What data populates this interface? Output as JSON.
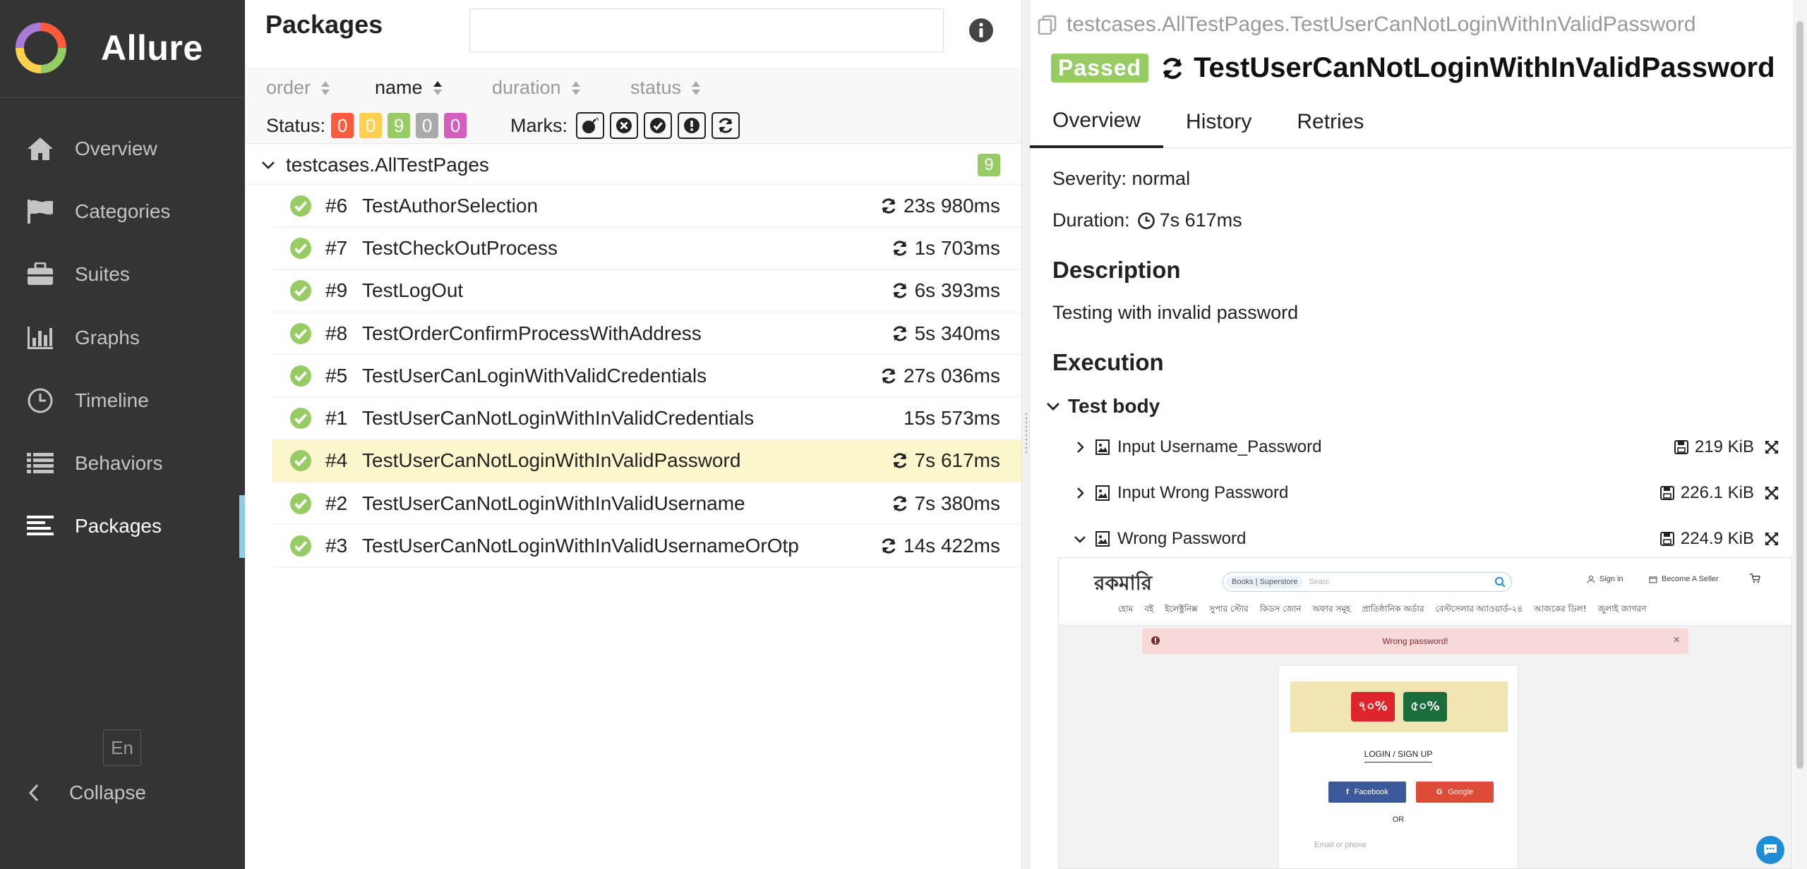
{
  "sidebar": {
    "brand": "Allure",
    "items": [
      {
        "label": "Overview",
        "icon": "home-icon"
      },
      {
        "label": "Categories",
        "icon": "flag-icon"
      },
      {
        "label": "Suites",
        "icon": "briefcase-icon"
      },
      {
        "label": "Graphs",
        "icon": "bar-chart-icon"
      },
      {
        "label": "Timeline",
        "icon": "clock-icon"
      },
      {
        "label": "Behaviors",
        "icon": "list-icon"
      },
      {
        "label": "Packages",
        "icon": "align-left-icon",
        "active": true
      }
    ],
    "language": "En",
    "collapse": "Collapse"
  },
  "packages": {
    "title": "Packages",
    "search_value": "",
    "sort": {
      "order": "order",
      "name": "name",
      "duration": "duration",
      "status": "status",
      "active": "name"
    },
    "status_label": "Status:",
    "status_counts": [
      {
        "count": "0",
        "color": "#fd5a3e"
      },
      {
        "count": "0",
        "color": "#ffd050"
      },
      {
        "count": "9",
        "color": "#97cc64"
      },
      {
        "count": "0",
        "color": "#aaaaaa"
      },
      {
        "count": "0",
        "color": "#d35ebe"
      }
    ],
    "marks_label": "Marks:",
    "marks": [
      "bomb-icon",
      "times-circle-icon",
      "check-circle-icon",
      "exclamation-circle-icon",
      "refresh-icon"
    ],
    "group": {
      "name": "testcases.AllTestPages",
      "count": "9"
    },
    "tests": [
      {
        "num": "#6",
        "name": "TestAuthorSelection",
        "duration": "23s 980ms",
        "retried": true
      },
      {
        "num": "#7",
        "name": "TestCheckOutProcess",
        "duration": "1s 703ms",
        "retried": true
      },
      {
        "num": "#9",
        "name": "TestLogOut",
        "duration": "6s 393ms",
        "retried": true
      },
      {
        "num": "#8",
        "name": "TestOrderConfirmProcessWithAddress",
        "duration": "5s 340ms",
        "retried": true
      },
      {
        "num": "#5",
        "name": "TestUserCanLoginWithValidCredentials",
        "duration": "27s 036ms",
        "retried": true
      },
      {
        "num": "#1",
        "name": "TestUserCanNotLoginWithInValidCredentials",
        "duration": "15s 573ms",
        "retried": false
      },
      {
        "num": "#4",
        "name": "TestUserCanNotLoginWithInValidPassword",
        "duration": "7s 617ms",
        "retried": true,
        "selected": true
      },
      {
        "num": "#2",
        "name": "TestUserCanNotLoginWithInValidUsername",
        "duration": "7s 380ms",
        "retried": true
      },
      {
        "num": "#3",
        "name": "TestUserCanNotLoginWithInValidUsernameOrOtp",
        "duration": "14s 422ms",
        "retried": true
      }
    ]
  },
  "detail": {
    "breadcrumb": "testcases.AllTestPages.TestUserCanNotLoginWithInValidPassword",
    "status": "Passed",
    "status_color": "#97cc64",
    "title": "TestUserCanNotLoginWithInValidPassword",
    "tabs": [
      "Overview",
      "History",
      "Retries"
    ],
    "severity": "Severity: normal",
    "duration_label": "Duration:",
    "duration": "7s 617ms",
    "description_heading": "Description",
    "description": "Testing with invalid password",
    "execution_heading": "Execution",
    "test_body": "Test body",
    "attachments": [
      {
        "name": "Input Username_Password",
        "size": "219 KiB",
        "expanded": false
      },
      {
        "name": "Input Wrong Password",
        "size": "226.1 KiB",
        "expanded": false
      },
      {
        "name": "Wrong Password",
        "size": "224.9 KiB",
        "expanded": true
      }
    ]
  },
  "screenshot": {
    "logo": "রকমারি",
    "search_tabs": [
      "Books",
      "Superstore"
    ],
    "search_placeholder": "Searc",
    "signin": "Sign in",
    "seller": "Become A Seller",
    "nav": [
      "হোম",
      "বই",
      "ইলেক্ট্রনিক্স",
      "সুপার স্টোর",
      "কিডস জোন",
      "অফার সমূহ",
      "প্রাতিষ্ঠানিক অর্ডার",
      "বেস্টসেলার অ্যাওয়ার্ড-২৪",
      "আজকের ডিল!",
      "জুলাই জাগরণ"
    ],
    "alert": "Wrong password!",
    "banner_left": "৭০%",
    "banner_right": "৫০%",
    "login_title": "LOGIN / SIGN UP",
    "facebook": "Facebook",
    "google": "Google",
    "or": "OR",
    "email_placeholder": "Email or phone"
  }
}
